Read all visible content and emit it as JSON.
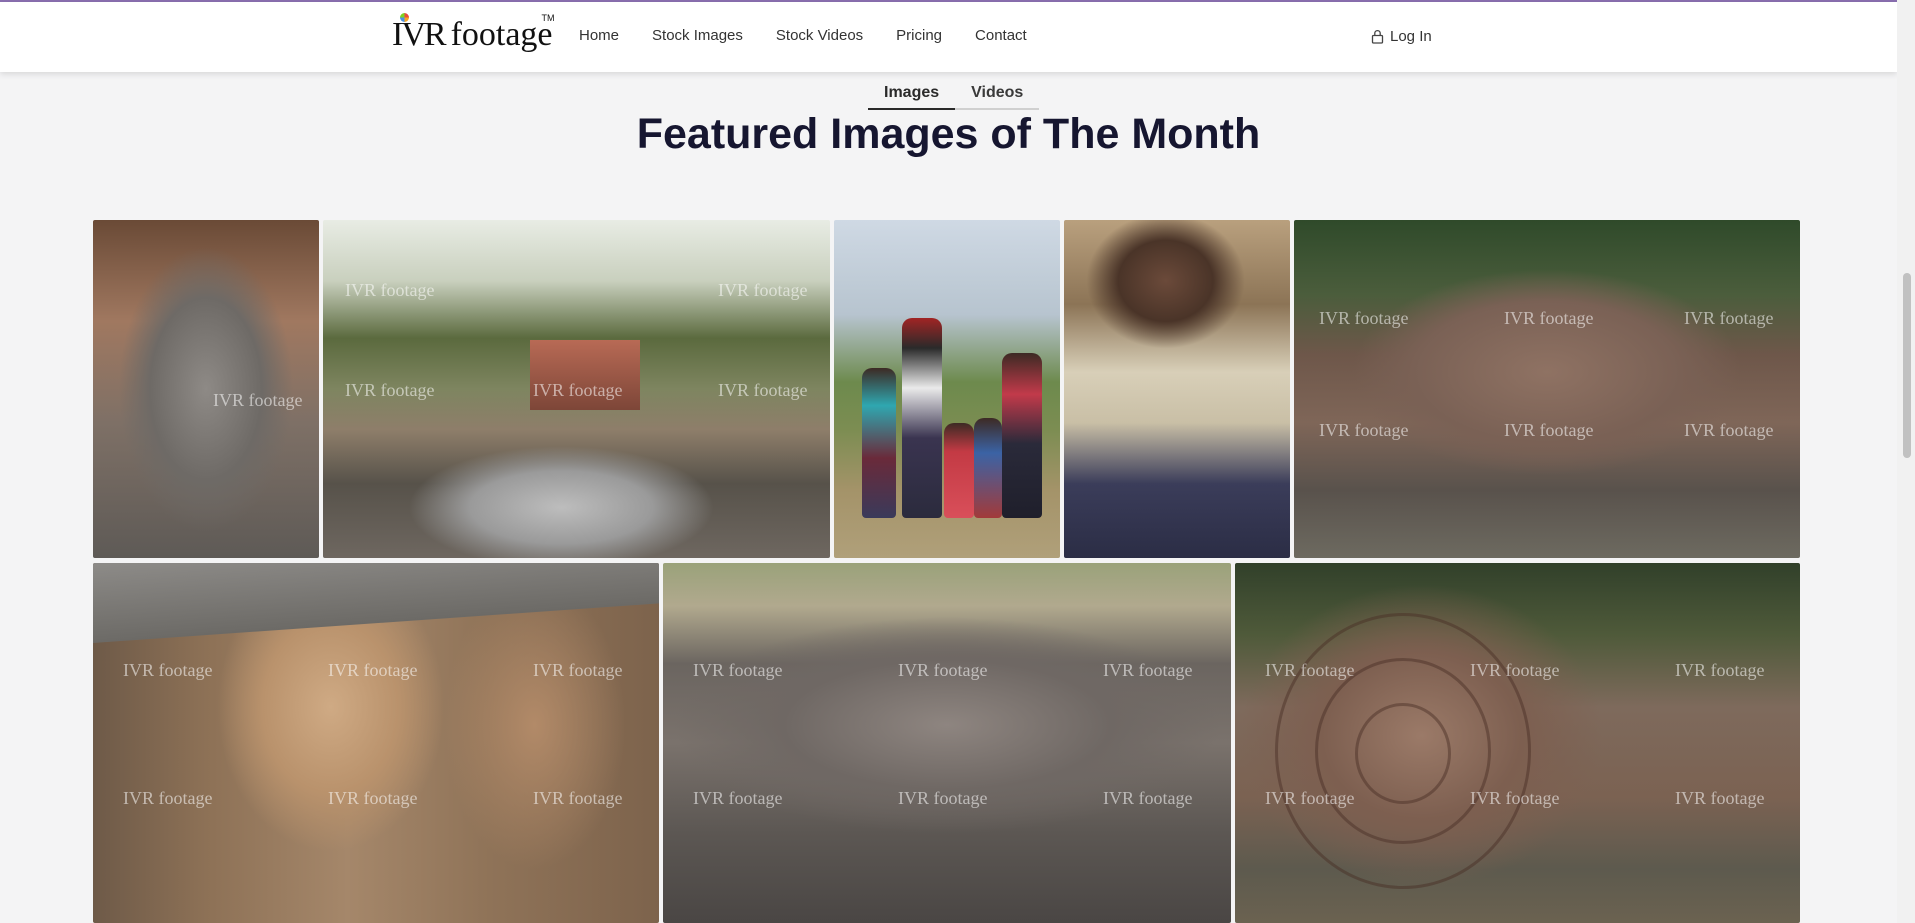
{
  "header": {
    "logo_mark": "IVR",
    "logo_word": "footage",
    "logo_tm": "TM",
    "nav": [
      "Home",
      "Stock Images",
      "Stock Videos",
      "Pricing",
      "Contact"
    ],
    "login_label": "Log In"
  },
  "tabs": [
    {
      "label": "Images",
      "active": true
    },
    {
      "label": "Videos",
      "active": false
    }
  ],
  "section_title": "Featured Images of The Month",
  "gallery": {
    "watermark": "IVR footage",
    "images": [
      "carved-stone-deity-fragment",
      "stone-ruins-with-shrine",
      "tribal-family-portrait",
      "elderly-woman-seated-portrait",
      "carved-stone-frieze-panel",
      "carved-stone-faces-row",
      "carved-frieze-with-archer",
      "carved-stone-lotus-capital"
    ]
  },
  "colors": {
    "accent_line": "#8a6fb0",
    "title": "#161630",
    "background": "#f4f4f5"
  }
}
